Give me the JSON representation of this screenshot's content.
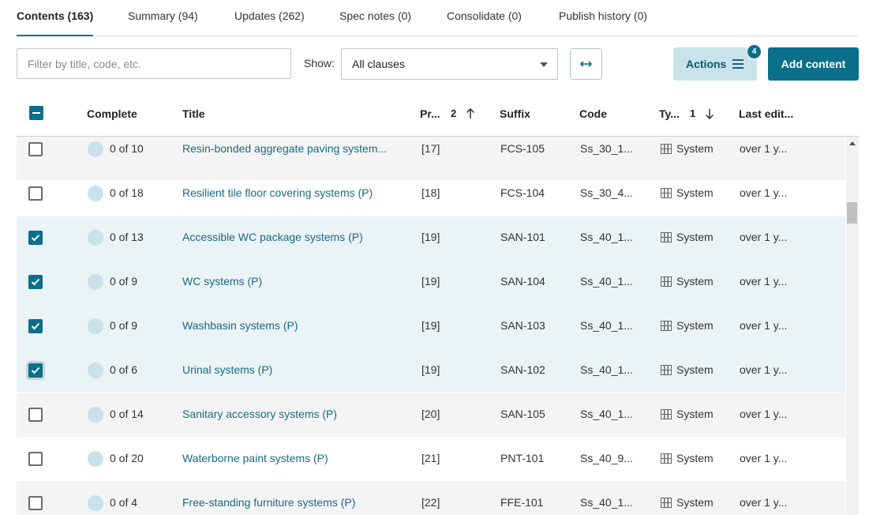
{
  "tabs": [
    {
      "label": "Contents (163)",
      "active": true
    },
    {
      "label": "Summary (94)"
    },
    {
      "label": "Updates (262)"
    },
    {
      "label": "Spec notes (0)"
    },
    {
      "label": "Consolidate (0)"
    },
    {
      "label": "Publish history (0)"
    }
  ],
  "toolbar": {
    "filter_placeholder": "Filter by title, code, etc.",
    "show_label": "Show:",
    "show_value": "All clauses",
    "actions_label": "Actions",
    "actions_badge": "4",
    "add_label": "Add content"
  },
  "table": {
    "headers": {
      "complete": "Complete",
      "title": "Title",
      "priority": "Pr...",
      "priority_sort": "2",
      "suffix": "Suffix",
      "code": "Code",
      "type": "Ty...",
      "type_sort": "1",
      "last_edited": "Last edit..."
    },
    "rows": [
      {
        "checked": false,
        "complete": "0 of 10",
        "title": "Resin-bonded aggregate paving system...",
        "priority": "[17]",
        "suffix": "FCS-105",
        "code": "Ss_30_1...",
        "type": "System",
        "last_edited": "over 1 y..."
      },
      {
        "checked": false,
        "complete": "0 of 18",
        "title": "Resilient tile floor covering systems (P)",
        "priority": "[18]",
        "suffix": "FCS-104",
        "code": "Ss_30_4...",
        "type": "System",
        "last_edited": "over 1 y..."
      },
      {
        "checked": true,
        "complete": "0 of 13",
        "title": "Accessible WC package systems (P)",
        "priority": "[19]",
        "suffix": "SAN-101",
        "code": "Ss_40_1...",
        "type": "System",
        "last_edited": "over 1 y..."
      },
      {
        "checked": true,
        "complete": "0 of 9",
        "title": "WC systems (P)",
        "priority": "[19]",
        "suffix": "SAN-104",
        "code": "Ss_40_1...",
        "type": "System",
        "last_edited": "over 1 y..."
      },
      {
        "checked": true,
        "complete": "0 of 9",
        "title": "Washbasin systems (P)",
        "priority": "[19]",
        "suffix": "SAN-103",
        "code": "Ss_40_1...",
        "type": "System",
        "last_edited": "over 1 y..."
      },
      {
        "checked": true,
        "complete": "0 of 6",
        "title": "Urinal systems (P)",
        "priority": "[19]",
        "suffix": "SAN-102",
        "code": "Ss_40_1...",
        "type": "System",
        "last_edited": "over 1 y..."
      },
      {
        "checked": false,
        "complete": "0 of 14",
        "title": "Sanitary accessory systems (P)",
        "priority": "[20]",
        "suffix": "SAN-105",
        "code": "Ss_40_1...",
        "type": "System",
        "last_edited": "over 1 y..."
      },
      {
        "checked": false,
        "complete": "0 of 20",
        "title": "Waterborne paint systems (P)",
        "priority": "[21]",
        "suffix": "PNT-101",
        "code": "Ss_40_9...",
        "type": "System",
        "last_edited": "over 1 y..."
      },
      {
        "checked": false,
        "complete": "0 of 4",
        "title": "Free-standing furniture systems (P)",
        "priority": "[22]",
        "suffix": "FFE-101",
        "code": "Ss_40_1...",
        "type": "System",
        "last_edited": "over 1 y..."
      }
    ]
  },
  "colors": {
    "accent": "#0a6f8a",
    "link": "#1a6a84",
    "selected_row": "#eaf3f6",
    "progress_circle": "#c8e1ea"
  },
  "icons": {
    "sort_asc": "arrow-up-icon",
    "sort_desc": "arrow-down-icon",
    "type": "grid-icon",
    "expand": "horizontal-expand-icon",
    "menu": "hamburger-icon"
  }
}
